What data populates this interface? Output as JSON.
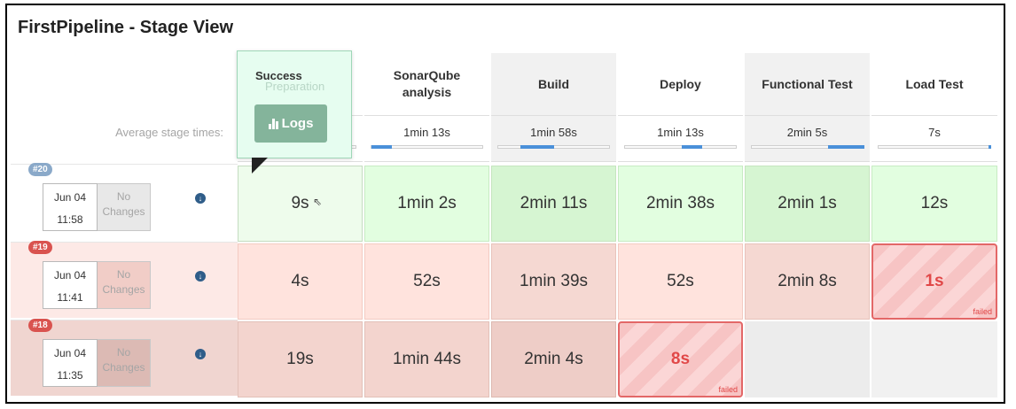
{
  "title": "FirstPipeline - Stage View",
  "avg_label": "Average stage times:",
  "tooltip": {
    "title": "Success",
    "ghost_stage": "Preparation",
    "logs_label": "Logs"
  },
  "stages": [
    {
      "name": "Preparation",
      "avg": "",
      "avg_fraction": 0
    },
    {
      "name": "SonarQube analysis",
      "avg": "1min 13s",
      "avg_fraction": 0.18
    },
    {
      "name": "Build",
      "avg": "1min 58s",
      "avg_fraction": 0.3
    },
    {
      "name": "Deploy",
      "avg": "1min 13s",
      "avg_fraction": 0.18
    },
    {
      "name": "Functional Test",
      "avg": "2min 5s",
      "avg_fraction": 0.32
    },
    {
      "name": "Load Test",
      "avg": "7s",
      "avg_fraction": 0.02
    }
  ],
  "runs": [
    {
      "id": "#20",
      "date": "Jun 04",
      "time": "11:58",
      "changes": "No Changes",
      "status": "success",
      "cells": [
        {
          "duration": "9s",
          "status": "success"
        },
        {
          "duration": "1min 2s",
          "status": "success"
        },
        {
          "duration": "2min 11s",
          "status": "success"
        },
        {
          "duration": "2min 38s",
          "status": "success"
        },
        {
          "duration": "2min 1s",
          "status": "success"
        },
        {
          "duration": "12s",
          "status": "success"
        }
      ]
    },
    {
      "id": "#19",
      "date": "Jun 04",
      "time": "11:41",
      "changes": "No Changes",
      "status": "failed",
      "cells": [
        {
          "duration": "4s",
          "status": "success"
        },
        {
          "duration": "52s",
          "status": "success"
        },
        {
          "duration": "1min 39s",
          "status": "success"
        },
        {
          "duration": "52s",
          "status": "success"
        },
        {
          "duration": "2min 8s",
          "status": "success"
        },
        {
          "duration": "1s",
          "status": "failed",
          "failed_label": "failed"
        }
      ]
    },
    {
      "id": "#18",
      "date": "Jun 04",
      "time": "11:35",
      "changes": "No Changes",
      "status": "failed",
      "cells": [
        {
          "duration": "19s",
          "status": "success"
        },
        {
          "duration": "1min 44s",
          "status": "success"
        },
        {
          "duration": "2min 4s",
          "status": "success"
        },
        {
          "duration": "8s",
          "status": "failed",
          "failed_label": "failed"
        },
        {
          "duration": "",
          "status": "not-run"
        },
        {
          "duration": "",
          "status": "not-run"
        }
      ]
    }
  ],
  "colors": {
    "success_badge": "#8aa9c9",
    "failed_badge": "#d9534f",
    "accent": "#4a90d9"
  }
}
